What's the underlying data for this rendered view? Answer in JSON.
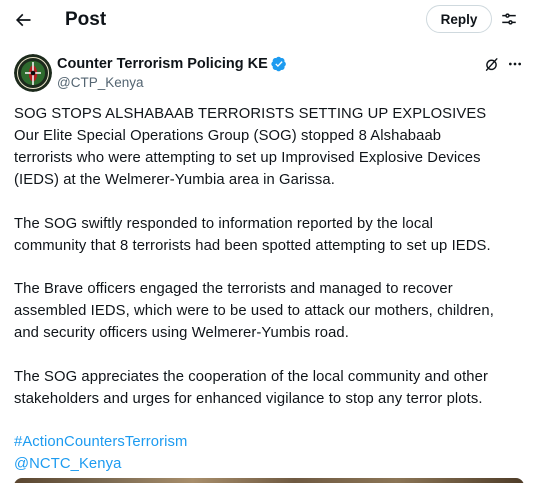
{
  "header": {
    "title": "Post",
    "reply_label": "Reply"
  },
  "author": {
    "name": "Counter Terrorism Policing KE",
    "handle": "@CTP_Kenya",
    "verified": true,
    "verified_color": "#1d9bf0"
  },
  "post": {
    "p1": [
      "SOG STOPS ALSHABAAB TERRORISTS SETTING UP EXPLOSIVES",
      "Our Elite Special Operations Group (SOG) stopped 8 Alshabaab",
      "terrorists who were attempting to set up Improvised Explosive Devices",
      "(IEDS) at the Welmerer-Yumbia area in Garissa."
    ],
    "p2": [
      "The SOG swiftly responded to information reported by the local",
      "community that 8 terrorists had been spotted attempting to set up IEDS."
    ],
    "p3": [
      "The Brave officers engaged the terrorists and managed to recover",
      "assembled IEDS, which were to be used to attack our mothers, children,",
      "and security officers using Welmerer-Yumbis road."
    ],
    "p4": [
      "The SOG appreciates the cooperation of the local community and other",
      "stakeholders and urges for enhanced vigilance to stop any terror plots."
    ],
    "hashtag": "#ActionCountersTerrorism",
    "mention": "@NCTC_Kenya"
  },
  "colors": {
    "link": "#1d9bf0",
    "secondary_text": "#536471",
    "border": "#cfd9de"
  }
}
